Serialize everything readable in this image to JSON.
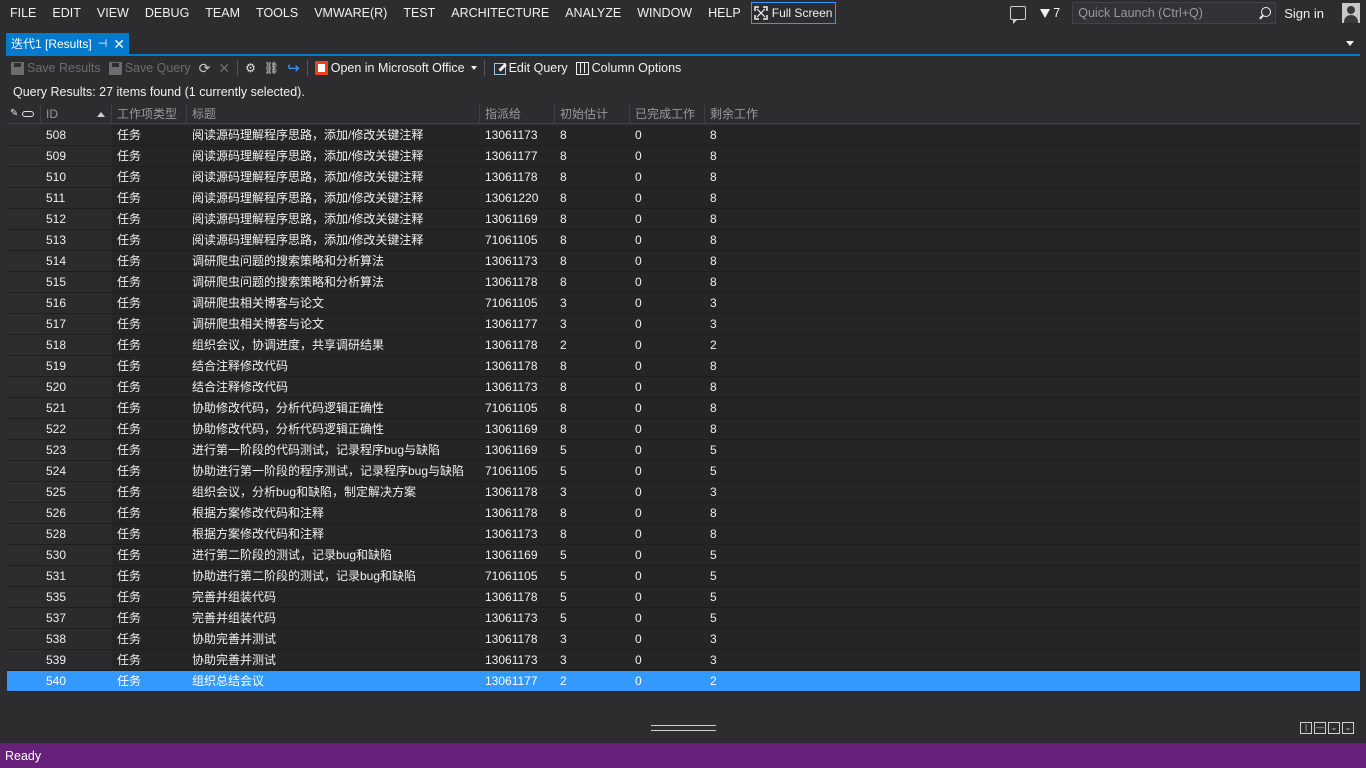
{
  "menu": {
    "items": [
      "FILE",
      "EDIT",
      "VIEW",
      "DEBUG",
      "TEAM",
      "TOOLS",
      "VMWARE(R)",
      "TEST",
      "ARCHITECTURE",
      "ANALYZE",
      "WINDOW",
      "HELP"
    ],
    "full_screen": "Full Screen",
    "notification_count": "7",
    "quick_launch_placeholder": "Quick Launch (Ctrl+Q)",
    "sign_in": "Sign in"
  },
  "tab": {
    "title": "迭代1 [Results]"
  },
  "toolbar": {
    "save_results": "Save Results",
    "save_query": "Save Query",
    "open_office": "Open in Microsoft Office",
    "edit_query": "Edit Query",
    "column_options": "Column Options"
  },
  "query_status": "Query Results: 27 items found (1 currently selected).",
  "grid": {
    "columns": [
      "ID",
      "工作项类型",
      "标题",
      "指派给",
      "初始估计",
      "已完成工作",
      "剩余工作"
    ],
    "rows": [
      [
        "508",
        "任务",
        "阅读源码理解程序思路，添加/修改关键注释",
        "13061173",
        "8",
        "0",
        "8"
      ],
      [
        "509",
        "任务",
        "阅读源码理解程序思路，添加/修改关键注释",
        "13061177",
        "8",
        "0",
        "8"
      ],
      [
        "510",
        "任务",
        "阅读源码理解程序思路，添加/修改关键注释",
        "13061178",
        "8",
        "0",
        "8"
      ],
      [
        "511",
        "任务",
        "阅读源码理解程序思路，添加/修改关键注释",
        "13061220",
        "8",
        "0",
        "8"
      ],
      [
        "512",
        "任务",
        "阅读源码理解程序思路，添加/修改关键注释",
        "13061169",
        "8",
        "0",
        "8"
      ],
      [
        "513",
        "任务",
        "阅读源码理解程序思路，添加/修改关键注释",
        "71061105",
        "8",
        "0",
        "8"
      ],
      [
        "514",
        "任务",
        "调研爬虫问题的搜索策略和分析算法",
        "13061173",
        "8",
        "0",
        "8"
      ],
      [
        "515",
        "任务",
        "调研爬虫问题的搜索策略和分析算法",
        "13061178",
        "8",
        "0",
        "8"
      ],
      [
        "516",
        "任务",
        "调研爬虫相关博客与论文",
        "71061105",
        "3",
        "0",
        "3"
      ],
      [
        "517",
        "任务",
        "调研爬虫相关博客与论文",
        "13061177",
        "3",
        "0",
        "3"
      ],
      [
        "518",
        "任务",
        "组织会议，协调进度，共享调研结果",
        "13061178",
        "2",
        "0",
        "2"
      ],
      [
        "519",
        "任务",
        "结合注释修改代码",
        "13061178",
        "8",
        "0",
        "8"
      ],
      [
        "520",
        "任务",
        "结合注释修改代码",
        "13061173",
        "8",
        "0",
        "8"
      ],
      [
        "521",
        "任务",
        "协助修改代码，分析代码逻辑正确性",
        "71061105",
        "8",
        "0",
        "8"
      ],
      [
        "522",
        "任务",
        "协助修改代码，分析代码逻辑正确性",
        "13061169",
        "8",
        "0",
        "8"
      ],
      [
        "523",
        "任务",
        "进行第一阶段的代码测试，记录程序bug与缺陷",
        "13061169",
        "5",
        "0",
        "5"
      ],
      [
        "524",
        "任务",
        "协助进行第一阶段的程序测试，记录程序bug与缺陷",
        "71061105",
        "5",
        "0",
        "5"
      ],
      [
        "525",
        "任务",
        "组织会议，分析bug和缺陷，制定解决方案",
        "13061178",
        "3",
        "0",
        "3"
      ],
      [
        "526",
        "任务",
        "根据方案修改代码和注释",
        "13061178",
        "8",
        "0",
        "8"
      ],
      [
        "528",
        "任务",
        "根据方案修改代码和注释",
        "13061173",
        "8",
        "0",
        "8"
      ],
      [
        "530",
        "任务",
        "进行第二阶段的测试，记录bug和缺陷",
        "13061169",
        "5",
        "0",
        "5"
      ],
      [
        "531",
        "任务",
        "协助进行第二阶段的测试，记录bug和缺陷",
        "71061105",
        "5",
        "0",
        "5"
      ],
      [
        "535",
        "任务",
        "完善并组装代码",
        "13061178",
        "5",
        "0",
        "5"
      ],
      [
        "537",
        "任务",
        "完善并组装代码",
        "13061173",
        "5",
        "0",
        "5"
      ],
      [
        "538",
        "任务",
        "协助完善并测试",
        "13061178",
        "3",
        "0",
        "3"
      ],
      [
        "539",
        "任务",
        "协助完善并测试",
        "13061173",
        "3",
        "0",
        "3"
      ],
      [
        "540",
        "任务",
        "组织总结会议",
        "13061177",
        "2",
        "0",
        "2"
      ]
    ],
    "selected_row": 26
  },
  "status_bar": "Ready",
  "colors": {
    "accent": "#007acc",
    "selection": "#3399ff",
    "status_bar": "#68217a"
  }
}
